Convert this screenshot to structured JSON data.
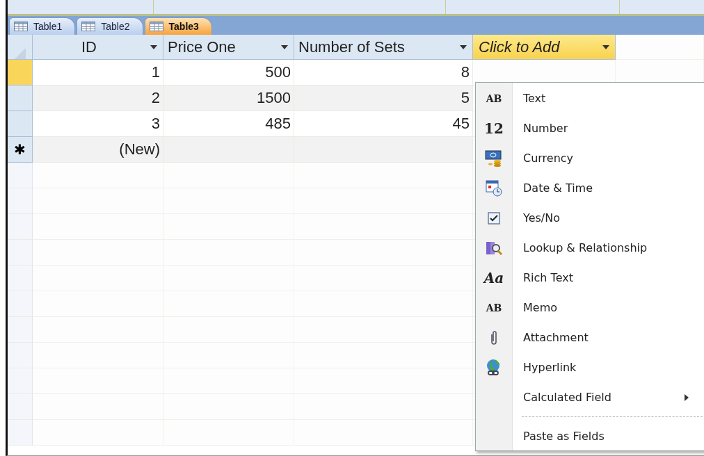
{
  "tabs": [
    {
      "label": "Table1",
      "selected": false
    },
    {
      "label": "Table2",
      "selected": false
    },
    {
      "label": "Table3",
      "selected": true
    }
  ],
  "table": {
    "columns": [
      {
        "label": "ID",
        "selected": false
      },
      {
        "label": "Price One",
        "selected": false
      },
      {
        "label": "Number of Sets",
        "selected": false
      },
      {
        "label": "Click to Add",
        "selected": true
      }
    ],
    "rows": [
      {
        "current": true,
        "cells": [
          "1",
          "500",
          "8"
        ]
      },
      {
        "current": false,
        "cells": [
          "2",
          "1500",
          "5"
        ]
      },
      {
        "current": false,
        "cells": [
          "3",
          "485",
          "45"
        ]
      }
    ],
    "new_row": {
      "marker": "✱",
      "cells": [
        "(New)"
      ]
    }
  },
  "menu": {
    "items": [
      {
        "kind": "glyph",
        "icon_text": "AB",
        "label": "Text"
      },
      {
        "kind": "glyph",
        "icon_text": "12",
        "label": "Number"
      },
      {
        "kind": "currency",
        "label": "Currency"
      },
      {
        "kind": "datetime",
        "label": "Date & Time"
      },
      {
        "kind": "checkbox",
        "label": "Yes/No"
      },
      {
        "kind": "lookup",
        "label": "Lookup & Relationship"
      },
      {
        "kind": "glyph",
        "icon_text": "Aa",
        "label": "Rich Text"
      },
      {
        "kind": "glyph",
        "icon_text": "AB",
        "label": "Memo"
      },
      {
        "kind": "paperclip",
        "label": "Attachment"
      },
      {
        "kind": "globe",
        "label": "Hyperlink"
      },
      {
        "kind": "submenu",
        "label": "Calculated Field"
      },
      {
        "kind": "separator"
      },
      {
        "kind": "plain",
        "label": "Paste as Fields"
      }
    ]
  }
}
